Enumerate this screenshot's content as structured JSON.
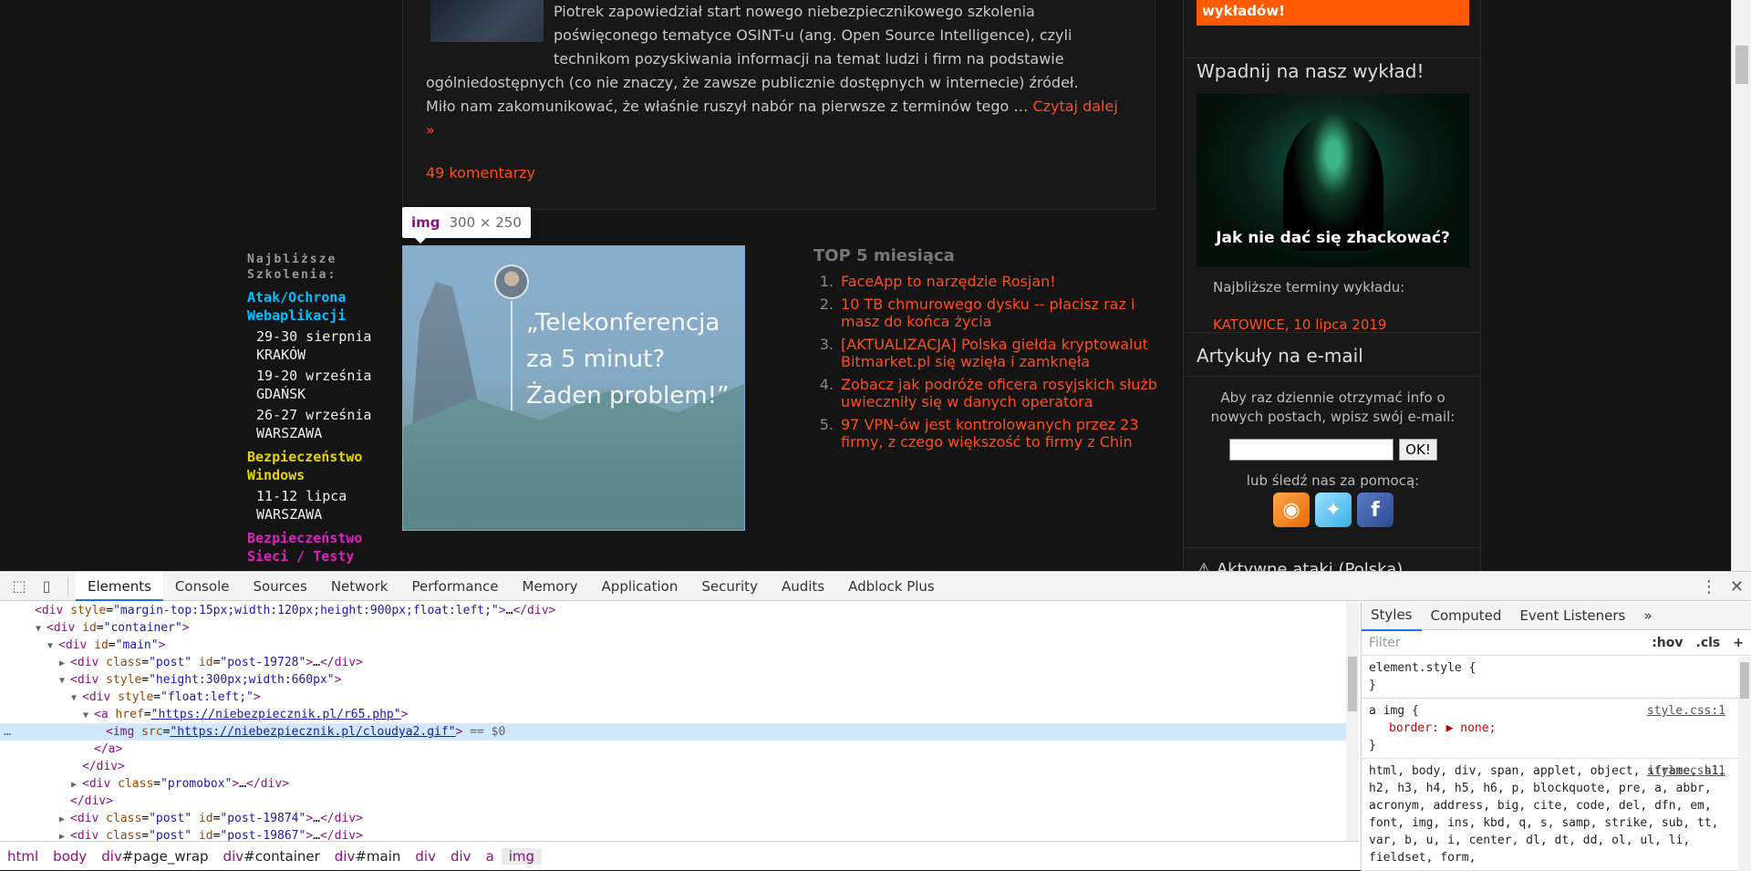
{
  "post": {
    "text_line1": "Piotrek zapowiedział start nowego niebezpiecznikowego szkolenia",
    "text_line2": "poświęconego tematyce OSINT-u (ang. Open Source Intelligence), czyli",
    "text_line3": "technikom pozyskiwania informacji na temat ludzi i firm na podstawie",
    "text_line4": "ogólniedostępnych (co nie znaczy, że zawsze publicznie dostępnych w internecie) źródeł.",
    "text_line5": "Miło nam zakomunikować, że właśnie ruszył nabór na pierwsze z terminów tego …",
    "read_more": "Czytaj dalej »",
    "comments": "49 komentarzy"
  },
  "tooltip": {
    "tag": "img",
    "dims": "300 × 250"
  },
  "banner": {
    "quote": "„Telekonferencja za 5 minut? Żaden problem!”"
  },
  "trainings": {
    "heading": "Najbliższe Szkolenia:",
    "groups": [
      {
        "title": "Atak/Ochrona Webaplikacji",
        "color": "#00bfff",
        "dates": [
          "29-30 sierpnia KRAKÓW",
          "19-20 września GDAŃSK",
          "26-27 września WARSZAWA"
        ]
      },
      {
        "title": "Bezpieczeństwo Windows",
        "color": "#e6d400",
        "dates": [
          "11-12 lipca WARSZAWA"
        ]
      },
      {
        "title": "Bezpieczeństwo Sieci / Testy",
        "color": "#e020c0",
        "dates": []
      }
    ]
  },
  "top5": {
    "title": "TOP 5 miesiąca",
    "items": [
      "FaceApp to narzędzie Rosjan!",
      "10 TB chmurowego dysku -- płacisz raz i masz do końca życia",
      "[AKTUALIZACJA] Polska giełda kryptowalut Bitmarket.pl się wzięła i zamknęła",
      "Zobacz jak podróże oficera rosyjskich służb uwieczniły się w danych operatora",
      "97 VPN-ów jest kontrolowanych przez 23 firmy, z czego większość to firmy z Chin"
    ]
  },
  "sidebar": {
    "orange_bar": "wykładów!",
    "lecture_title": "Wpadnij na nasz wykład!",
    "hood_caption": "Jak nie dać się zhackować?",
    "near_dates": "Najbliższe terminy wykładu:",
    "katowice": "KATOWICE, 10 lipca 2019",
    "email_title": "Artykuły na e-mail",
    "email_text": "Aby raz dziennie otrzymać info o nowych postach, wpisz swój e-mail:",
    "ok": "OK!",
    "follow": "lub śledź nas za pomocą:",
    "alert_peek": "⚠ Aktywne ataki (Polska)"
  },
  "devtools": {
    "tabs": [
      "Elements",
      "Console",
      "Sources",
      "Network",
      "Performance",
      "Memory",
      "Application",
      "Security",
      "Audits",
      "Adblock Plus"
    ],
    "active_tab": "Elements",
    "dom_lines": [
      {
        "indent": 2,
        "html": "<div style=\"margin-top:15px;width:120px;height:900px;float:left;\">…</div>"
      },
      {
        "indent": 3,
        "html": "▼<div id=\"container\">"
      },
      {
        "indent": 4,
        "html": "▼<div id=\"main\">"
      },
      {
        "indent": 5,
        "html": "▶<div class=\"post\" id=\"post-19728\">…</div>"
      },
      {
        "indent": 5,
        "html": "▼<div style=\"height:300px;width:660px\">"
      },
      {
        "indent": 6,
        "html": "▼<div style=\"float:left;\">"
      },
      {
        "indent": 7,
        "html": "▼<a href=\"https://niebezpiecznik.pl/r65.php\">"
      },
      {
        "indent": 8,
        "html": "<img src=\"https://niebezpiecznik.pl/cloudya2.gif\"> == $0"
      },
      {
        "indent": 7,
        "html": "</a>"
      },
      {
        "indent": 6,
        "html": "</div>"
      },
      {
        "indent": 6,
        "html": "▶<div class=\"promobox\">…</div>"
      },
      {
        "indent": 5,
        "html": "</div>"
      },
      {
        "indent": 5,
        "html": "▶<div class=\"post\" id=\"post-19874\">…</div>"
      },
      {
        "indent": 5,
        "html": "▶<div class=\"post\" id=\"post-19867\">…</div>"
      }
    ],
    "breadcrumb": [
      "html",
      "body",
      "div#page_wrap",
      "div#container",
      "div#main",
      "div",
      "div",
      "a",
      "img"
    ],
    "styles_tabs": [
      "Styles",
      "Computed",
      "Event Listeners",
      "»"
    ],
    "filter_placeholder": "Filter",
    "filter_hov": ":hov",
    "filter_cls": ".cls",
    "rules": [
      {
        "selector": "element.style {",
        "body": "}",
        "source": ""
      },
      {
        "selector": "a img {",
        "prop": "border: ▶ none;",
        "body": "}",
        "source": "style.css:1"
      },
      {
        "selector": "html, body, div, span, applet, object, iframe, h1, h2, h3, h4, h5, h6, p, blockquote, pre, a, abbr, acronym, address, big, cite, code, del, dfn, em, font, img, ins, kbd, q, s, samp, strike, sub, tt, var, b, u, i, center, dl, dt, dd, ol, ul, li, fieldset, form,",
        "source": "style.css:1"
      }
    ]
  }
}
